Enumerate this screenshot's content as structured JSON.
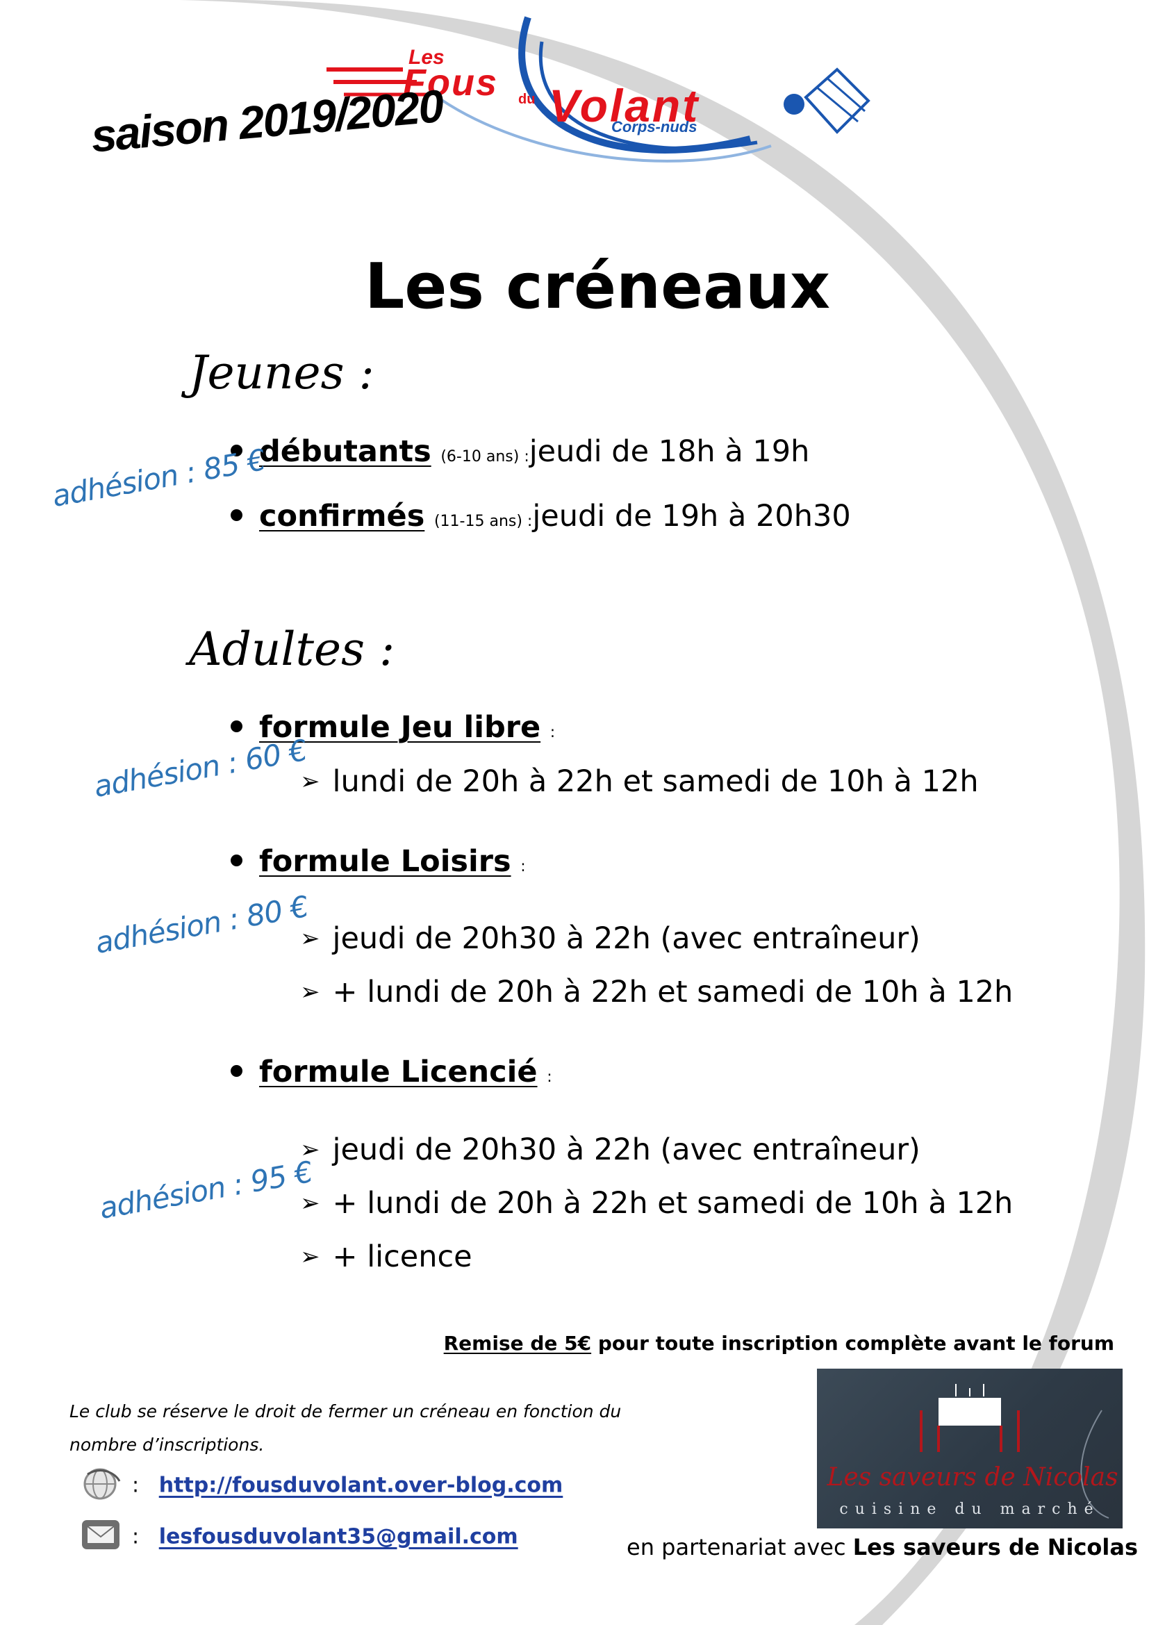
{
  "logo": {
    "line1": "Les",
    "line2": "Fous",
    "line3": "du",
    "line4": "Volant",
    "line5": "Corps-nuds"
  },
  "season": "saison 2019/2020",
  "title": "Les créneaux",
  "jeunes": {
    "heading": "Jeunes :",
    "fee": "adhésion : 85 €",
    "items": [
      {
        "label": "débutants",
        "ages": "(6-10 ans) :",
        "schedule": "jeudi de 18h à 19h"
      },
      {
        "label": "confirmés",
        "ages": "(11-15 ans) :",
        "schedule": "jeudi de 19h à 20h30"
      }
    ]
  },
  "adultes": {
    "heading": "Adultes :",
    "formules": [
      {
        "label": "formule Jeu libre",
        "colon": ":",
        "fee": "adhésion : 60 €",
        "lines": [
          "lundi de 20h à 22h et samedi de 10h à 12h"
        ]
      },
      {
        "label": "formule Loisirs",
        "colon": ":",
        "fee": "adhésion : 80 €",
        "lines": [
          "jeudi de 20h30 à 22h (avec entraîneur)",
          "+ lundi de 20h à 22h et samedi de 10h à 12h"
        ]
      },
      {
        "label": "formule Licencié",
        "colon": ":",
        "fee": "adhésion : 95 €",
        "lines": [
          "jeudi de 20h30 à 22h (avec entraîneur)",
          "+ lundi de 20h à 22h et samedi de 10h à 12h",
          "+ licence"
        ]
      }
    ]
  },
  "remise": {
    "bold_underlined": "Remise de 5€",
    "rest": " pour toute inscription complète avant le forum"
  },
  "note": "Le club se réserve le droit de fermer un créneau en fonction du nombre d’inscriptions.",
  "contacts": {
    "separator": ":",
    "website": "http://fousduvolant.over-blog.com",
    "email": "lesfousduvolant35@gmail.com"
  },
  "partner": {
    "name": "Les saveurs de Nicolas",
    "subtitle": "cuisine du marché",
    "text_prefix": "en partenariat avec ",
    "text_bold": "Les saveurs de Nicolas"
  },
  "icons": [
    "globe-icon",
    "envelope-icon",
    "shuttlecock-icon",
    "table-icon"
  ],
  "colors": {
    "fee_blue": "#2e74b5",
    "logo_red": "#e3131c",
    "logo_blue": "#1a56b0",
    "arc_gray": "#d0d0d0",
    "link_blue": "#1f3fa0",
    "partner_red": "#b3161b"
  }
}
